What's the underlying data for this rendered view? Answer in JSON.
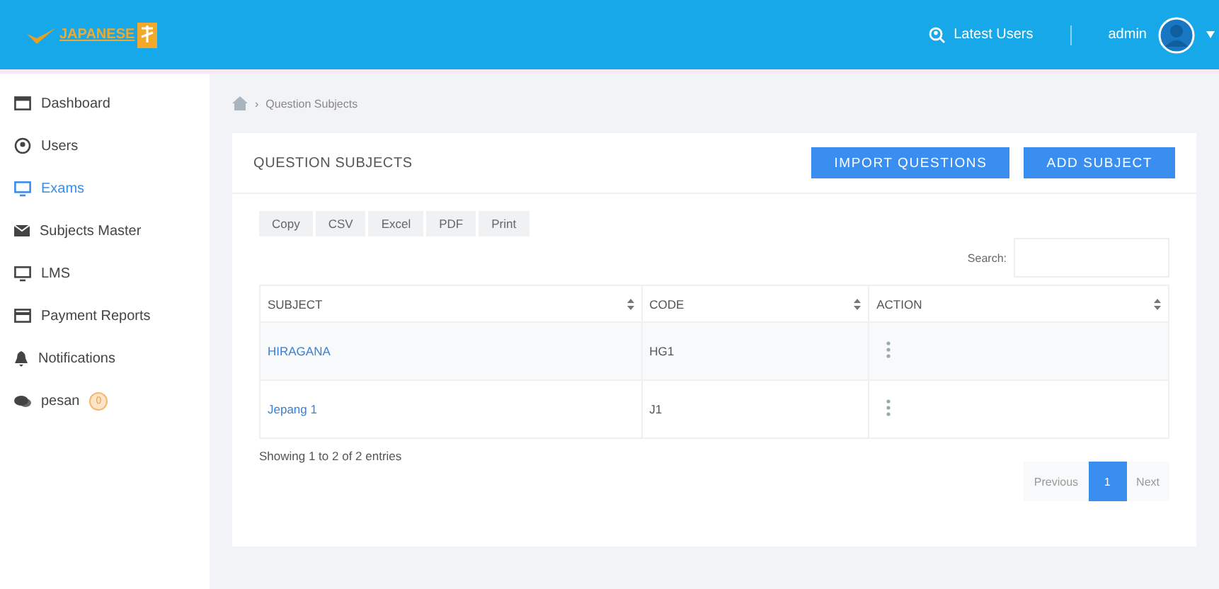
{
  "header": {
    "logo": "JAPANESE",
    "latest_users": "Latest Users",
    "user": "admin"
  },
  "sidebar": {
    "items": [
      {
        "label": "Dashboard",
        "kind": "calendar",
        "selected": false
      },
      {
        "label": "Users",
        "kind": "user",
        "selected": false
      },
      {
        "label": "Exams",
        "kind": "monitor",
        "selected": true
      },
      {
        "label": "Subjects Master",
        "kind": "mail",
        "selected": false
      },
      {
        "label": "LMS",
        "kind": "monitor",
        "selected": false
      },
      {
        "label": "Payment Reports",
        "kind": "card",
        "selected": false
      },
      {
        "label": "Notifications",
        "kind": "bell",
        "selected": false
      },
      {
        "label": "pesan",
        "kind": "chat",
        "selected": false,
        "badge": "0"
      }
    ]
  },
  "breadcrumb": {
    "separator": "›",
    "current": "Question Subjects"
  },
  "card": {
    "title": "QUESTION SUBJECTS",
    "actions": [
      "IMPORT QUESTIONS",
      "ADD SUBJECT"
    ],
    "export_buttons": [
      "Copy",
      "CSV",
      "Excel",
      "PDF",
      "Print"
    ],
    "search_label": "Search:",
    "table": {
      "columns": [
        "SUBJECT",
        "CODE",
        "ACTION"
      ],
      "rows": [
        {
          "subject": "HIRAGANA",
          "code": "HG1"
        },
        {
          "subject": "Jepang 1",
          "code": "J1"
        }
      ]
    },
    "info": "Showing 1 to 2 of 2 entries",
    "pagination": {
      "previous": "Previous",
      "pages": [
        {
          "label": "1",
          "selected": true
        }
      ],
      "next": "Next"
    }
  }
}
